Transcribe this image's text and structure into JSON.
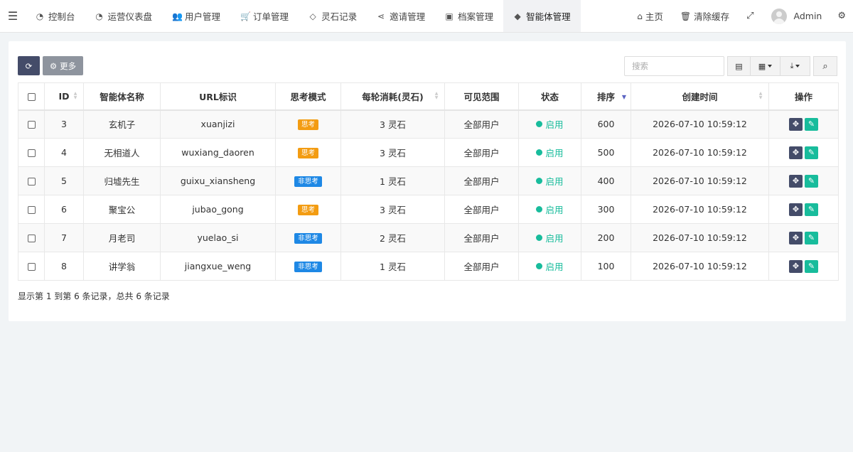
{
  "nav": {
    "tabs": [
      {
        "label": "控制台",
        "icon": "dashboard-icon",
        "glyph": "◔"
      },
      {
        "label": "运营仪表盘",
        "icon": "dashboard-icon",
        "glyph": "◔"
      },
      {
        "label": "用户管理",
        "icon": "users-icon",
        "glyph": "👥"
      },
      {
        "label": "订单管理",
        "icon": "cart-icon",
        "glyph": "🛒"
      },
      {
        "label": "灵石记录",
        "icon": "diamond-icon",
        "glyph": "◇"
      },
      {
        "label": "邀请管理",
        "icon": "share-icon",
        "glyph": "⋖"
      },
      {
        "label": "档案管理",
        "icon": "contact-book-icon",
        "glyph": "▣"
      },
      {
        "label": "智能体管理",
        "icon": "android-icon",
        "glyph": "◆",
        "active": true
      }
    ],
    "home_label": "主页",
    "clear_cache_label": "清除缓存",
    "user_name": "Admin"
  },
  "toolbar": {
    "more_label": "更多",
    "search_placeholder": "搜索"
  },
  "table": {
    "columns": [
      "ID",
      "智能体名称",
      "URL标识",
      "思考模式",
      "每轮消耗(灵石)",
      "可见范围",
      "状态",
      "排序",
      "创建时间",
      "操作"
    ],
    "rows": [
      {
        "id": "3",
        "name": "玄机子",
        "url": "xuanjizi",
        "mode": "思考",
        "cost": "3 灵石",
        "scope": "全部用户",
        "status": "启用",
        "sort": "600",
        "created": "2026-07-10 10:59:12"
      },
      {
        "id": "4",
        "name": "无相道人",
        "url": "wuxiang_daoren",
        "mode": "思考",
        "cost": "3 灵石",
        "scope": "全部用户",
        "status": "启用",
        "sort": "500",
        "created": "2026-07-10 10:59:12"
      },
      {
        "id": "5",
        "name": "归墟先生",
        "url": "guixu_xiansheng",
        "mode": "非思考",
        "cost": "1 灵石",
        "scope": "全部用户",
        "status": "启用",
        "sort": "400",
        "created": "2026-07-10 10:59:12"
      },
      {
        "id": "6",
        "name": "聚宝公",
        "url": "jubao_gong",
        "mode": "思考",
        "cost": "3 灵石",
        "scope": "全部用户",
        "status": "启用",
        "sort": "300",
        "created": "2026-07-10 10:59:12"
      },
      {
        "id": "7",
        "name": "月老司",
        "url": "yuelao_si",
        "mode": "非思考",
        "cost": "2 灵石",
        "scope": "全部用户",
        "status": "启用",
        "sort": "200",
        "created": "2026-07-10 10:59:12"
      },
      {
        "id": "8",
        "name": "讲学翁",
        "url": "jiangxue_weng",
        "mode": "非思考",
        "cost": "1 灵石",
        "scope": "全部用户",
        "status": "启用",
        "sort": "100",
        "created": "2026-07-10 10:59:12"
      }
    ]
  },
  "pagination": {
    "info": "显示第 1 到第 6 条记录，总共 6 条记录"
  },
  "colors": {
    "primary": "#444c69",
    "success": "#18bc9c",
    "warning": "#f39c12",
    "info": "#1e88e5"
  }
}
